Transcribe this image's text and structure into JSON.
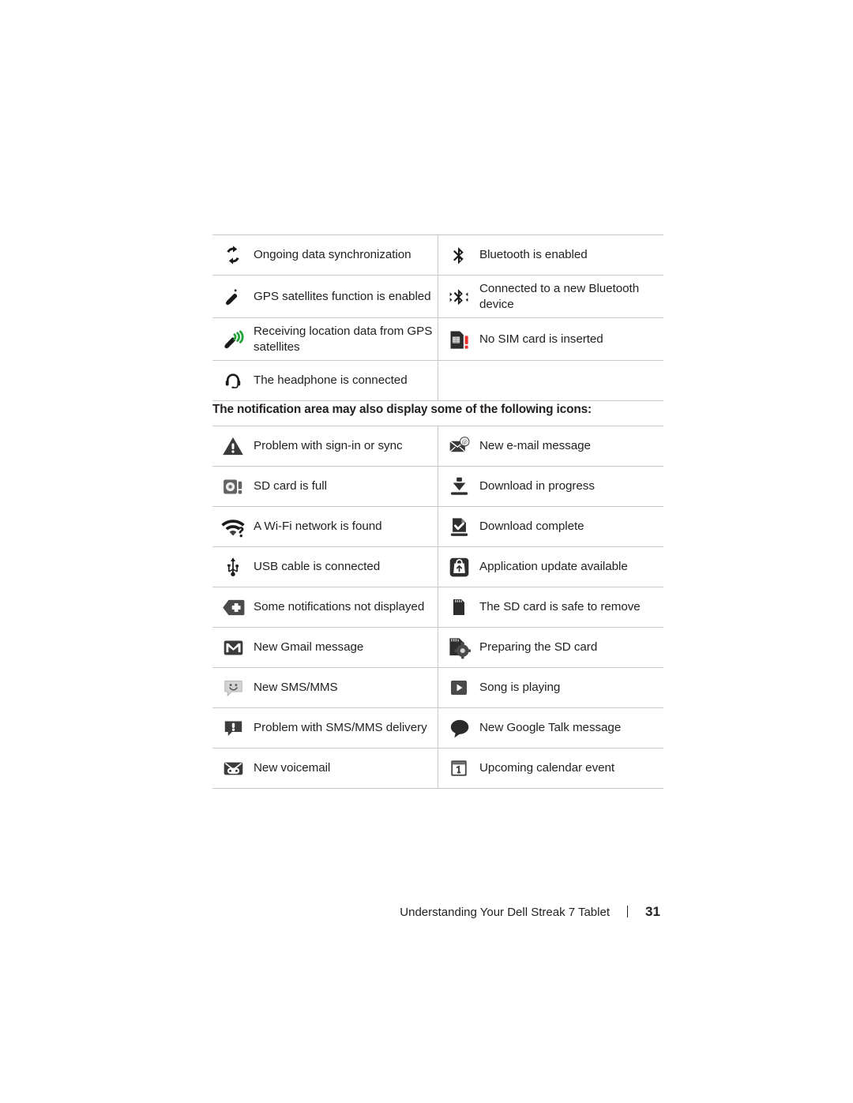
{
  "document": {
    "page_number": "31",
    "footer_text": "Understanding Your Dell Streak 7 Tablet"
  },
  "notification_heading": "The notification area may also display some of the following icons:",
  "status_table": {
    "rows": [
      {
        "left": {
          "icon": "sync-icon",
          "label": "Ongoing data synchronization"
        },
        "right": {
          "icon": "bluetooth-icon",
          "label": "Bluetooth is enabled"
        }
      },
      {
        "left": {
          "icon": "gps-satellite-icon",
          "label": "GPS satellites function is enabled"
        },
        "right": {
          "icon": "bluetooth-connected-icon",
          "label": "Connected to a new Bluetooth device"
        }
      },
      {
        "left": {
          "icon": "gps-receiving-icon",
          "label": "Receiving location data from GPS satellites"
        },
        "right": {
          "icon": "no-sim-card-icon",
          "label": "No SIM card is inserted"
        }
      },
      {
        "left": {
          "icon": "headphone-icon",
          "label": "The headphone is connected"
        },
        "right": {
          "icon": "",
          "label": ""
        }
      }
    ]
  },
  "notification_table": {
    "rows": [
      {
        "left": {
          "icon": "warning-triangle-icon",
          "label": "Problem with sign-in or sync"
        },
        "right": {
          "icon": "email-icon",
          "label": "New e-mail message"
        }
      },
      {
        "left": {
          "icon": "sd-card-full-icon",
          "label": "SD card is full"
        },
        "right": {
          "icon": "download-progress-icon",
          "label": "Download in progress"
        }
      },
      {
        "left": {
          "icon": "wifi-found-icon",
          "label": "A Wi-Fi network is found"
        },
        "right": {
          "icon": "download-complete-icon",
          "label": "Download complete"
        }
      },
      {
        "left": {
          "icon": "usb-icon",
          "label": "USB cable is connected"
        },
        "right": {
          "icon": "app-update-icon",
          "label": "Application update available"
        }
      },
      {
        "left": {
          "icon": "more-notifications-icon",
          "label": "Some notifications not displayed"
        },
        "right": {
          "icon": "sd-card-icon",
          "label": "The SD card is safe to remove"
        }
      },
      {
        "left": {
          "icon": "gmail-icon",
          "label": "New Gmail message"
        },
        "right": {
          "icon": "sd-card-preparing-icon",
          "label": "Preparing the SD card"
        }
      },
      {
        "left": {
          "icon": "sms-mms-icon",
          "label": "New SMS/MMS"
        },
        "right": {
          "icon": "play-icon",
          "label": "Song is playing"
        }
      },
      {
        "left": {
          "icon": "sms-problem-icon",
          "label": "Problem with SMS/MMS delivery"
        },
        "right": {
          "icon": "google-talk-icon",
          "label": "New Google Talk message"
        }
      },
      {
        "left": {
          "icon": "voicemail-icon",
          "label": "New voicemail"
        },
        "right": {
          "icon": "calendar-event-icon",
          "label": "Upcoming calendar event"
        }
      }
    ]
  },
  "colors": {
    "text": "#231f20",
    "rule": "#c9c9c9",
    "gps_green": "#22a23a",
    "alert_red": "#e8312a"
  }
}
